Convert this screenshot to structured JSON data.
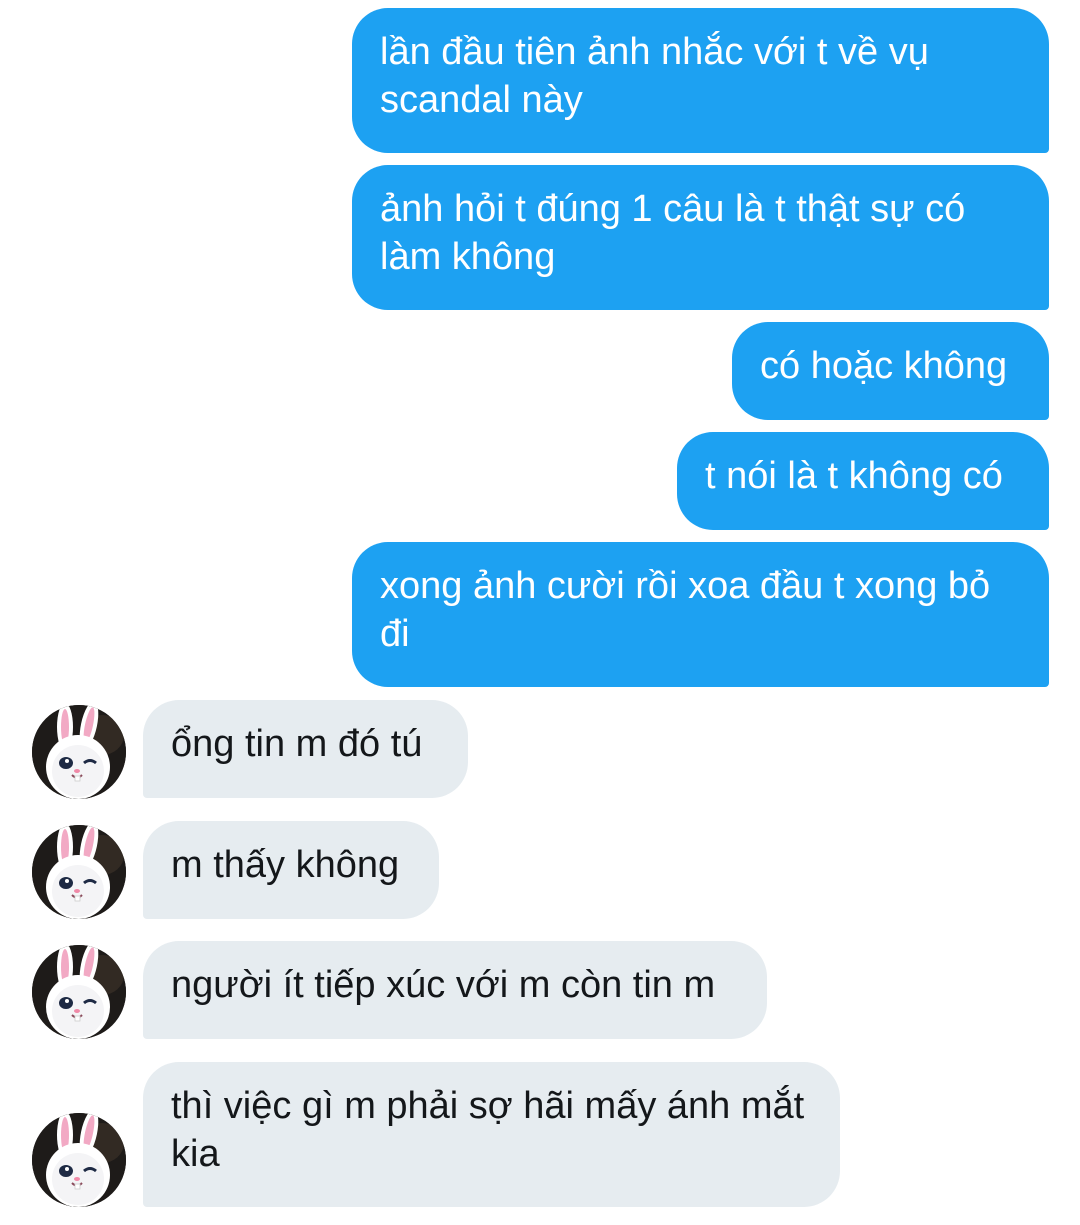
{
  "messages": [
    {
      "direction": "sent",
      "text": "lần đầu tiên ảnh nhắc với t về vụ scandal này"
    },
    {
      "direction": "sent",
      "text": "ảnh hỏi t đúng 1 câu là t thật sự có làm không"
    },
    {
      "direction": "sent",
      "text": "có hoặc không"
    },
    {
      "direction": "sent",
      "text": "t nói là t không có"
    },
    {
      "direction": "sent",
      "text": "xong ảnh cười rồi xoa đầu t xong bỏ đi"
    },
    {
      "direction": "received",
      "text": "ổng tin m đó tú",
      "avatar": "white-bunny-avatar"
    },
    {
      "direction": "received",
      "text": "m thấy không",
      "avatar": "white-bunny-avatar"
    },
    {
      "direction": "received",
      "text": "người ít tiếp xúc với m còn tin m",
      "avatar": "white-bunny-avatar"
    },
    {
      "direction": "received",
      "text": "thì việc gì m phải sợ hãi mấy ánh mắt kia",
      "avatar": "white-bunny-avatar"
    }
  ],
  "colors": {
    "sent_bubble": "#1da1f2",
    "sent_text": "#ffffff",
    "received_bubble": "#e6ecf0",
    "received_text": "#14171a"
  }
}
